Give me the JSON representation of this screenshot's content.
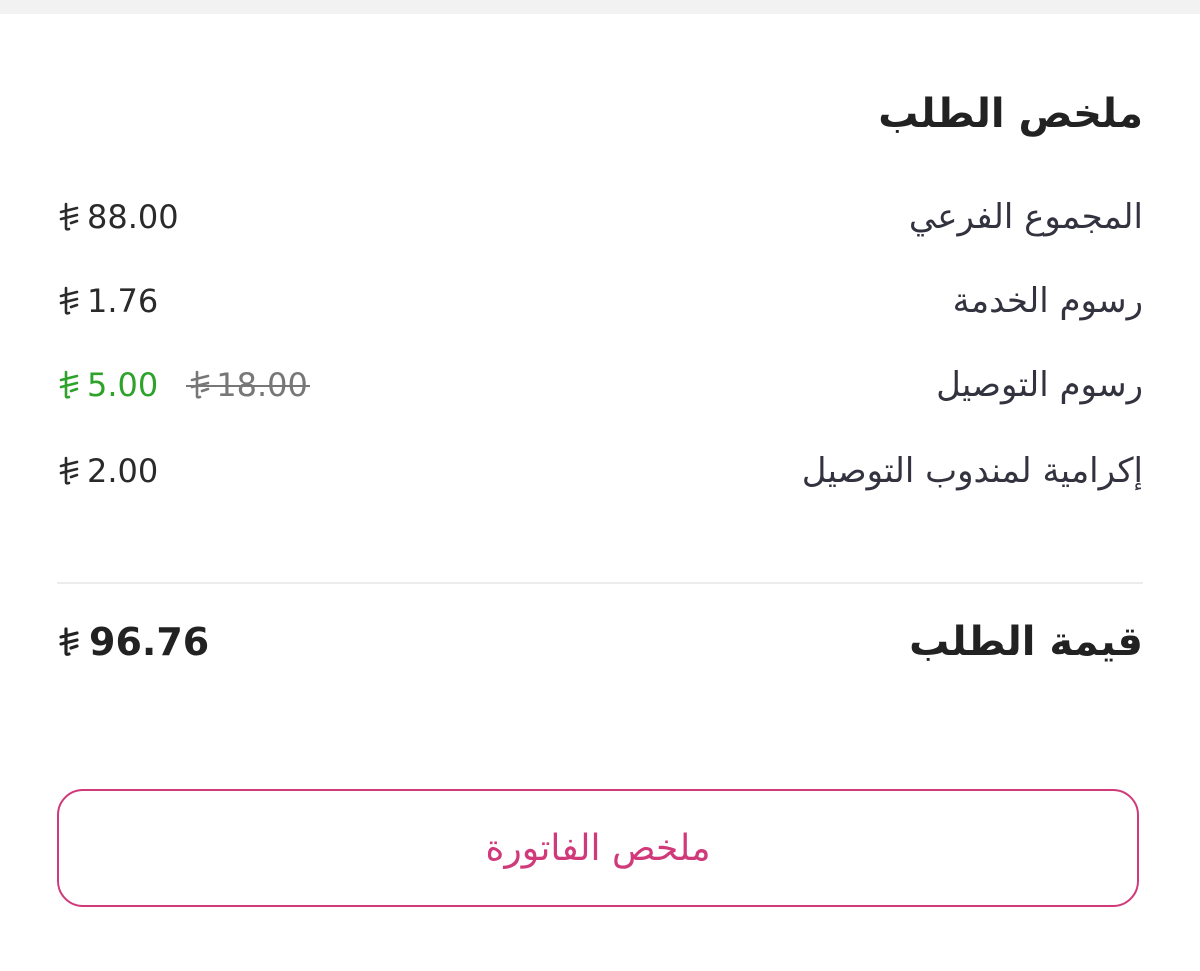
{
  "summary": {
    "title": "ملخص الطلب",
    "rows": [
      {
        "label": "المجموع الفرعي",
        "amount": "88.00"
      },
      {
        "label": "رسوم الخدمة",
        "amount": "1.76"
      },
      {
        "label": "رسوم التوصيل",
        "old_amount": "18.00",
        "amount": "5.00"
      },
      {
        "label": "إكرامية لمندوب التوصيل",
        "amount": "2.00"
      }
    ]
  },
  "total": {
    "label": "قيمة الطلب",
    "amount": "96.76"
  },
  "invoice_button": {
    "label": "ملخص الفاتورة"
  },
  "currency_icon": "riyal-symbol-icon",
  "colors": {
    "accent": "#d0397a",
    "discount": "#2ea22b",
    "strikethrough": "#777777",
    "text": "#222222"
  }
}
